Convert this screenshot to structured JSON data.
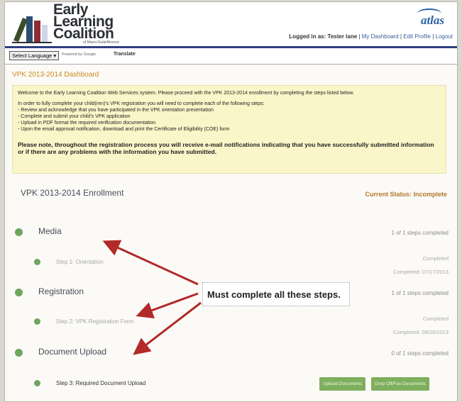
{
  "logo": {
    "line1": "Early",
    "line2": "Learning",
    "line3": "Coalition",
    "sub": "of Miami-Dade/Monroe"
  },
  "brand": "atlas",
  "userbar": {
    "logged_in": "Logged in as: Tester lane",
    "dashboard": "My Dashboard",
    "edit_profile": "Edit Profile",
    "logout": "Logout",
    "sep": "|"
  },
  "nav": {
    "language": "Select Language ▾",
    "powered": "Powered by Google",
    "translate": "Translate"
  },
  "dashboard_title": "VPK 2013-2014 Dashboard",
  "notice": {
    "welcome": "Welcome to the Early Learning Coalition Web Services system. Please proceed with the VPK 2013-2014 enrollment by completing the steps listed below.",
    "intro": "In order to fully complete your child(ren)'s VPK registration you will need to complete each of the following steps:",
    "steps": [
      "- Review and acknowledge that you have participated in the VPK orientation presentation",
      "- Complete  and submit your child's VPK application",
      "- Upload in PDF format the required verification documentation",
      "- Upon the email approval notification, download and print the Certificate of Eligibility (COE) form"
    ],
    "bold": "Please note, throughout the registration process you will receive e-mail notifications indicating that you have successfully submitted information or if there are any problems with the information you have submitted."
  },
  "enrollment": {
    "title": "VPK 2013-2014 Enrollment",
    "status": "Current Status: Incomplete",
    "sections": [
      {
        "title": "Media",
        "progress": "1 of 1 steps completed",
        "step": "Step 1: Orientation",
        "state": "Completed",
        "date": "Completed: 07/17/2013"
      },
      {
        "title": "Registration",
        "progress": "1 of 1 steps completed",
        "step": "Step 2: VPK Registration Form",
        "state": "Completed",
        "date": "Completed: 08/29/2013"
      },
      {
        "title": "Document Upload",
        "progress": "0 of 1 steps completed",
        "step": "Step 3: Required Document Upload"
      }
    ],
    "buttons": {
      "upload": "Upload Documents",
      "drop": "Drop Off/Fax Documents"
    }
  },
  "callout": "Must complete all these steps.",
  "colors": {
    "accent": "#d28a1e",
    "green": "#6fa55f",
    "arrow": "#b22a2a",
    "navbar": "#2e3f80"
  }
}
